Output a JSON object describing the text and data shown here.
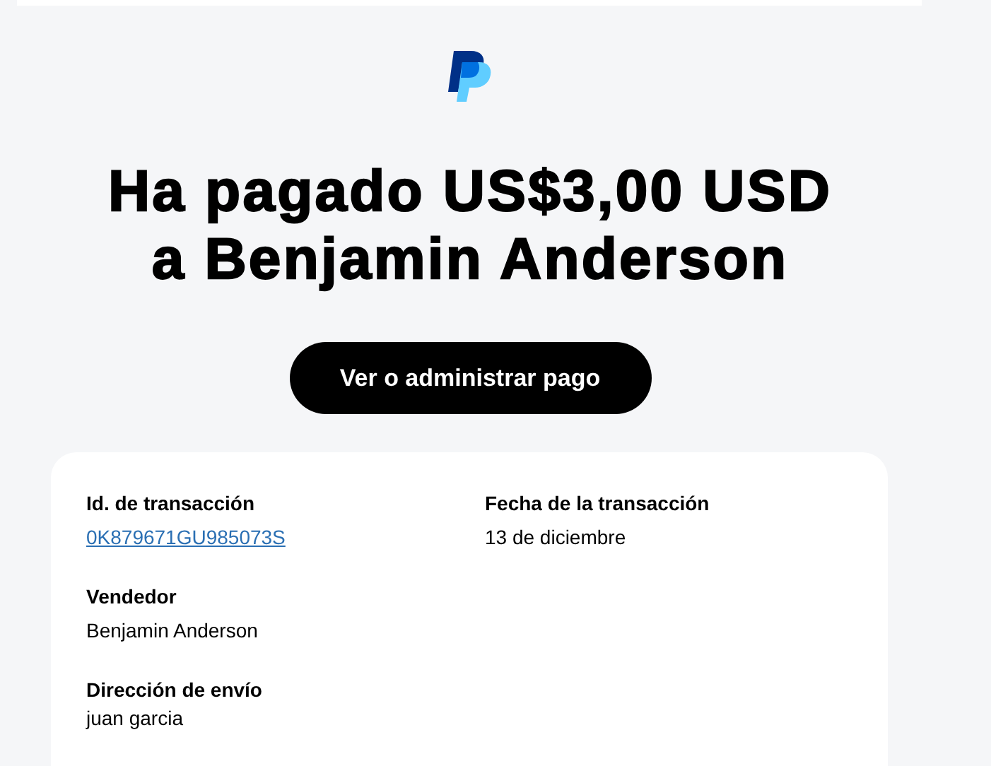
{
  "heading": [
    "Ha pagado US$3,00 USD",
    "a Benjamin Anderson"
  ],
  "button": "Ver o administrar pago",
  "details": [
    {
      "label": "Id. de transacción",
      "value": "0K879671GU985073S",
      "kind": "link"
    },
    {
      "label": "Fecha de la transacción",
      "value": "13 de diciembre",
      "kind": "text"
    },
    {
      "label": "Vendedor",
      "value": "Benjamin Anderson",
      "kind": "text"
    },
    {
      "label": "Dirección de envío",
      "value": "juan garcia",
      "kind": "text"
    }
  ]
}
